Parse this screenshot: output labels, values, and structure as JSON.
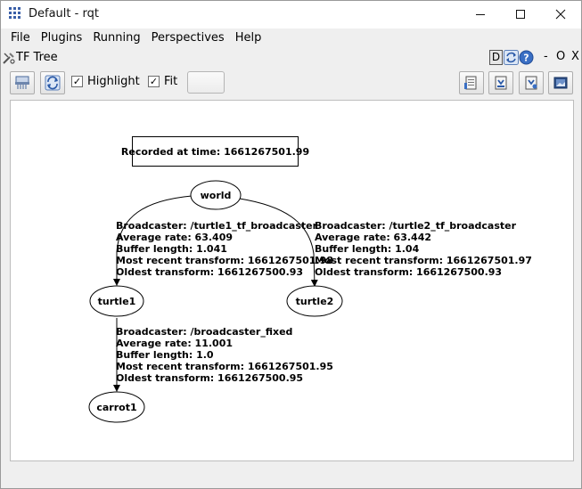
{
  "window": {
    "title": "Default - rqt",
    "minimize_label": "–",
    "maximize_label": "☐",
    "close_label": "✕"
  },
  "menu": [
    "File",
    "Plugins",
    "Running",
    "Perspectives",
    "Help"
  ],
  "plugin": {
    "title": "TF Tree",
    "dock_d": "D",
    "dock_dash": "-",
    "dock_o": "O",
    "dock_x": "X"
  },
  "toolbar": {
    "highlight_label": "Highlight",
    "highlight_checked": true,
    "fit_label": "Fit",
    "fit_checked": true,
    "check_mark": "✓"
  },
  "graph": {
    "recorded": "Recorded at time: 1661267501.99",
    "nodes": {
      "world": "world",
      "turtle1": "turtle1",
      "turtle2": "turtle2",
      "carrot1": "carrot1"
    },
    "edge_turtle1": [
      "Broadcaster: /turtle1_tf_broadcaster",
      "Average rate: 63.409",
      "Buffer length: 1.041",
      "Most recent transform: 1661267501.98",
      "Oldest transform: 1661267500.93"
    ],
    "edge_turtle2": [
      "Broadcaster: /turtle2_tf_broadcaster",
      "Average rate: 63.442",
      "Buffer length: 1.04",
      "Most recent transform: 1661267501.97",
      "Oldest transform: 1661267500.93"
    ],
    "edge_carrot1": [
      "Broadcaster: /broadcaster_fixed",
      "Average rate: 11.001",
      "Buffer length: 1.0",
      "Most recent transform: 1661267501.95",
      "Oldest transform: 1661267500.95"
    ]
  }
}
